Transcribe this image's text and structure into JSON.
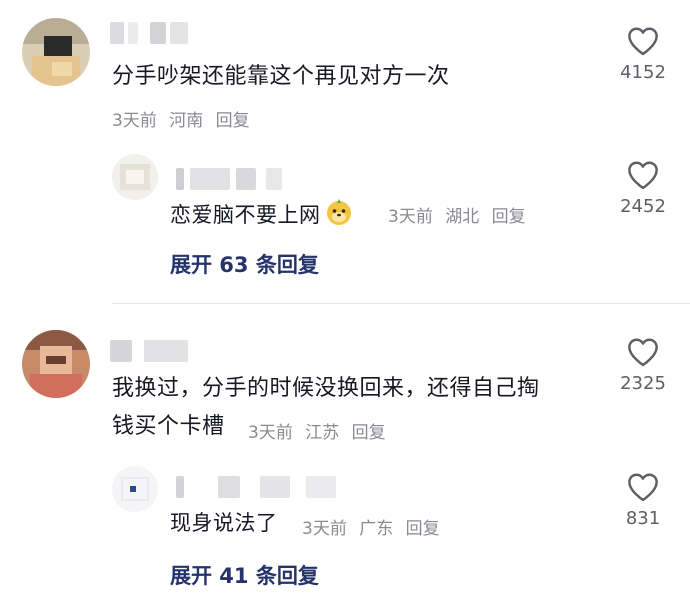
{
  "comments": [
    {
      "text": "分手吵架还能靠这个再见对方一次",
      "time": "3天前",
      "location": "河南",
      "reply_label": "回复",
      "likes": "4152",
      "reply": {
        "text": "恋爱脑不要上网",
        "emoji": "doge-face-emoji",
        "time": "3天前",
        "location": "湖北",
        "reply_label": "回复",
        "likes": "2452"
      },
      "expand_label": "展开 63 条回复"
    },
    {
      "text_line1": "我换过，分手的时候没换回来，还得自己掏",
      "text_line2": "钱买个卡槽",
      "time": "3天前",
      "location": "江苏",
      "reply_label": "回复",
      "likes": "2325",
      "reply": {
        "text": "现身说法了",
        "time": "3天前",
        "location": "广东",
        "reply_label": "回复",
        "likes": "831"
      },
      "expand_label": "展开 41 条回复"
    }
  ],
  "colors": {
    "text": "#161823",
    "meta": "#8a8b91",
    "link": "#25336b",
    "icon": "#5e5f66"
  }
}
